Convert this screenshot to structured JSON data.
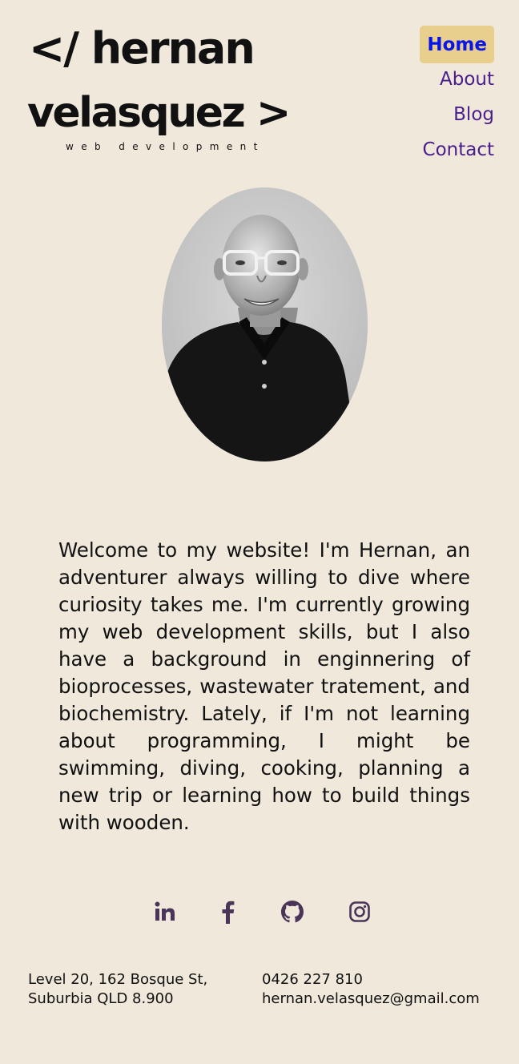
{
  "logo": {
    "line1": "</ hernan",
    "line2": "velasquez >",
    "subtitle": "web development"
  },
  "nav": {
    "items": [
      {
        "label": "Home",
        "active": true
      },
      {
        "label": "About",
        "active": false
      },
      {
        "label": "Blog",
        "active": false
      },
      {
        "label": "Contact",
        "active": false
      }
    ]
  },
  "colors": {
    "background": "#efe8db",
    "nav_link": "#4a1d8c",
    "nav_active_bg": "#e9cf8e",
    "nav_active_text": "#0a16e8",
    "social_icon": "#4a3558"
  },
  "intro": {
    "text": "Welcome to my website! I'm Hernan, an adventurer always willing to dive where curiosity takes me. I'm currently growing my web development skills, but I also have a background in enginnering of bioprocesses, wastewater tratement, and biochemistry. Lately, if I'm not learning about programming, I might be swimming, diving, cooking, planning a new trip or learning how to build things with wooden."
  },
  "social": [
    {
      "icon": "linkedin-icon"
    },
    {
      "icon": "facebook-icon"
    },
    {
      "icon": "github-icon"
    },
    {
      "icon": "instagram-icon"
    }
  ],
  "footer": {
    "address_line1": "Level 20, 162 Bosque St,",
    "address_line2": "Suburbia QLD 8.900",
    "phone": "0426 227 810",
    "email": "hernan.velasquez@gmail.com"
  }
}
